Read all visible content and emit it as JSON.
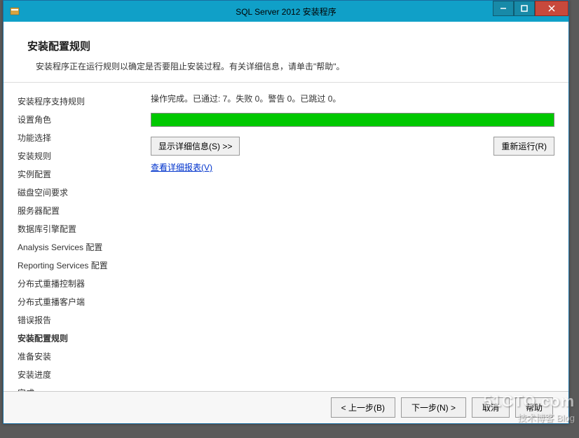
{
  "titlebar": {
    "title": "SQL Server 2012 安装程序"
  },
  "header": {
    "title": "安装配置规则",
    "description": "安装程序正在运行规则以确定是否要阻止安装过程。有关详细信息，请单击\"帮助\"。"
  },
  "sidebar": {
    "items": [
      {
        "label": "安装程序支持规则",
        "active": false
      },
      {
        "label": "设置角色",
        "active": false
      },
      {
        "label": "功能选择",
        "active": false
      },
      {
        "label": "安装规则",
        "active": false
      },
      {
        "label": "实例配置",
        "active": false
      },
      {
        "label": "磁盘空间要求",
        "active": false
      },
      {
        "label": "服务器配置",
        "active": false
      },
      {
        "label": "数据库引擎配置",
        "active": false
      },
      {
        "label": "Analysis Services 配置",
        "active": false
      },
      {
        "label": "Reporting Services 配置",
        "active": false
      },
      {
        "label": "分布式重播控制器",
        "active": false
      },
      {
        "label": "分布式重播客户端",
        "active": false
      },
      {
        "label": "错误报告",
        "active": false
      },
      {
        "label": "安装配置规则",
        "active": true
      },
      {
        "label": "准备安装",
        "active": false
      },
      {
        "label": "安装进度",
        "active": false
      },
      {
        "label": "完成",
        "active": false
      }
    ]
  },
  "main": {
    "status_text": "操作完成。已通过: 7。失败 0。警告 0。已跳过 0。",
    "show_details_btn": "显示详细信息(S) >>",
    "rerun_btn": "重新运行(R)",
    "view_report_link": "查看详细报表(V)"
  },
  "footer": {
    "back_btn": "< 上一步(B)",
    "next_btn": "下一步(N) >",
    "cancel_btn": "取消",
    "help_btn": "帮助"
  },
  "watermark": {
    "line1": "51CTO.com",
    "line2": "技术博客 Blog"
  }
}
